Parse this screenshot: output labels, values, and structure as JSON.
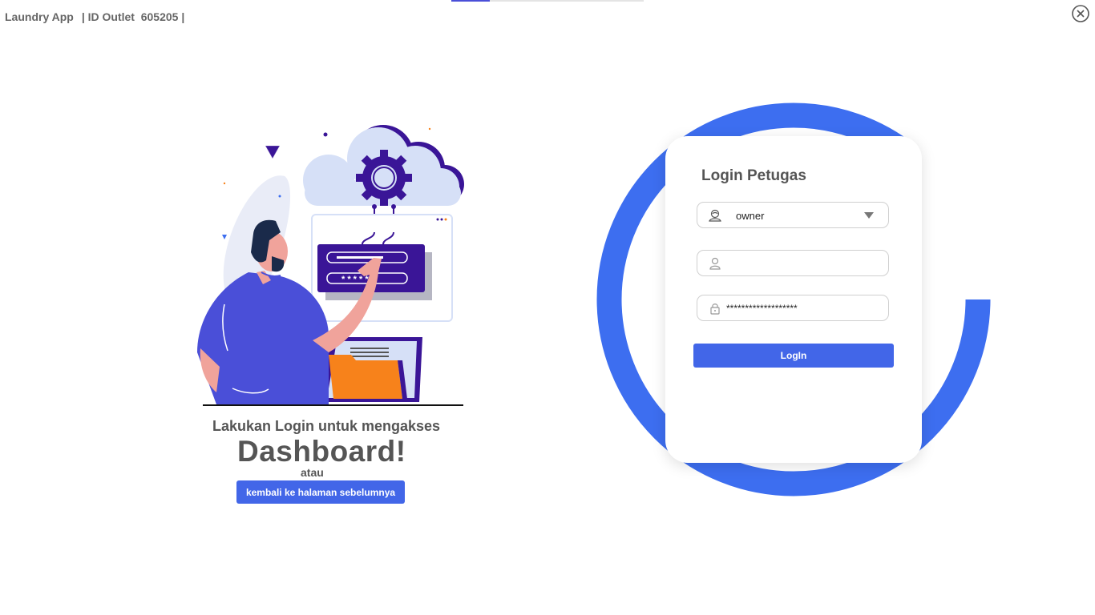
{
  "window": {
    "app_name": "Laundry App",
    "outlet_label": "| ID Outlet  605205 |",
    "close_icon": "close-circle-icon",
    "loading_progress": 0.2
  },
  "hero": {
    "headline": "Lakukan Login untuk mengakses",
    "emphasis": "Dashboard!",
    "or_text": "atau",
    "back_button_label": "kembali ke halaman sebelumnya",
    "password_chars_shown": "* * * * * *"
  },
  "login": {
    "title": "Login Petugas",
    "role_field": {
      "value": "owner",
      "icon": "user-badge-icon"
    },
    "username_field": {
      "value": "",
      "icon": "user-icon"
    },
    "password_field": {
      "value": "*******************",
      "icon": "lock-icon"
    },
    "submit_label": "LogIn"
  },
  "colors": {
    "accent": "#4266e8",
    "ring": "#3d6ef0",
    "illustration_purple": "#3a1597",
    "illustration_orange": "#f7821b"
  }
}
